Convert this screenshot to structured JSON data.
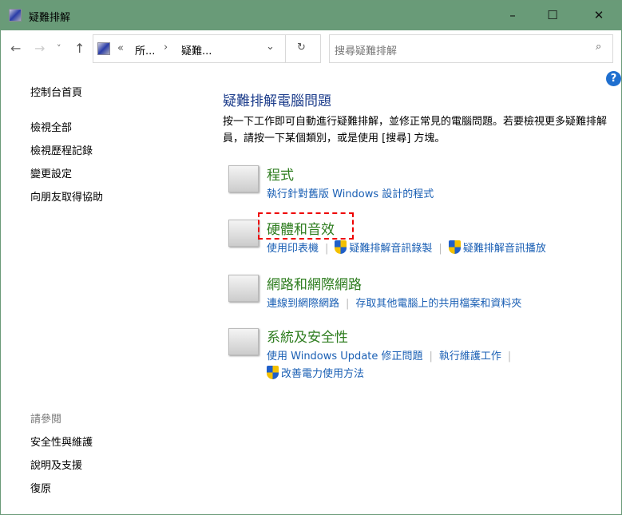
{
  "window": {
    "title": "疑難排解",
    "minimize": "–",
    "maximize": "☐",
    "close": "✕"
  },
  "toolbar": {
    "back": "←",
    "forward": "→",
    "recent": "˅",
    "up": "↑",
    "breadcrumb_overflow": "«",
    "crumb1": "所...",
    "crumb_sep": "›",
    "crumb2": "疑難...",
    "dropdown": "⌄",
    "refresh": "↻",
    "search_placeholder": "搜尋疑難排解",
    "search_icon": "⌕"
  },
  "left": {
    "items": [
      "控制台首頁",
      "檢視全部",
      "檢視歷程記錄",
      "變更設定",
      "向朋友取得協助"
    ],
    "see_also": "請參閱",
    "see_also_items": [
      "安全性與維護",
      "說明及支援",
      "復原"
    ]
  },
  "main": {
    "title": "疑難排解電腦問題",
    "description": "按一下工作即可自動進行疑難排解，並修正常見的電腦問題。若要檢視更多疑難排解員，請按一下某個類別，或是使用 [搜尋] 方塊。",
    "categories": [
      {
        "heading": "程式",
        "links": [
          "執行針對舊版 Windows 設計的程式"
        ]
      },
      {
        "heading": "硬體和音效",
        "links": [
          "使用印表機",
          "疑難排解音訊錄製",
          "疑難排解音訊播放"
        ]
      },
      {
        "heading": "網路和網際網路",
        "links": [
          "連線到網際網路",
          "存取其他電腦上的共用檔案和資料夾"
        ]
      },
      {
        "heading": "系統及安全性",
        "links": [
          "使用 Windows Update 修正問題",
          "執行維護工作",
          "改善電力使用方法"
        ]
      }
    ]
  },
  "help": "?"
}
